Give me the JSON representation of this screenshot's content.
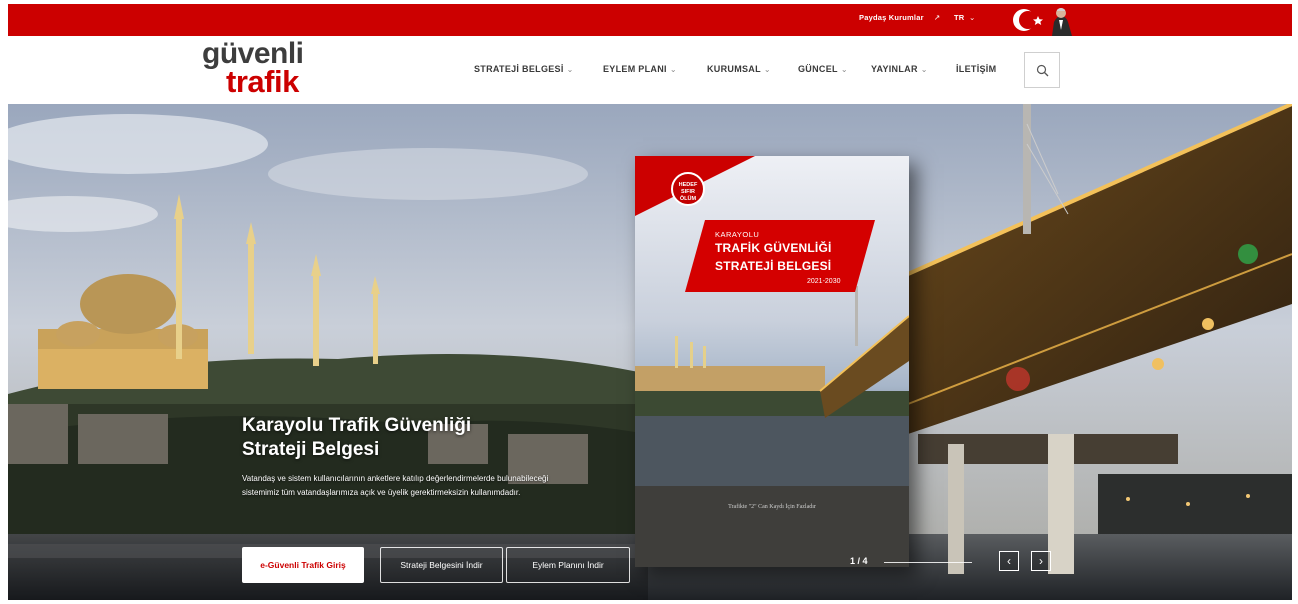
{
  "topbar": {
    "stakeholders_label": "Paydaş Kurumlar",
    "stakeholders_icon": "external-link-icon",
    "stakeholders_arrow": "↗",
    "language": "TR",
    "language_chevron": "⌄",
    "flag_icon": "turkish-flag-crescent-star-icon",
    "bg_color": "#cc0000"
  },
  "logo": {
    "line1": "güvenli",
    "line2": "trafik"
  },
  "nav": {
    "items": [
      {
        "label": "STRATEJİ BELGESİ",
        "chev": "⌄"
      },
      {
        "label": "EYLEM PLANI",
        "chev": "⌄"
      },
      {
        "label": "KURUMSAL",
        "chev": "⌄"
      },
      {
        "label": "GÜNCEL",
        "chev": "⌄"
      },
      {
        "label": "YAYINLAR",
        "chev": "⌄"
      },
      {
        "label": "İLETİŞİM",
        "chev": ""
      }
    ],
    "search_icon": "search-icon"
  },
  "hero": {
    "title_line1": "Karayolu Trafik Güvenliği",
    "title_line2": "Strateji Belgesi",
    "description": "Vatandaş ve sistem kullanıcılarının anketlere katılıp değerlendirmelerde bulunabileceği sistemimiz tüm vatandaşlarımıza açık ve üyelik gerektirmeksizin kullanımdadır.",
    "buttons": {
      "primary": "e-Güvenli Trafik Giriş",
      "strategy": "Strateji Belgesini İndir",
      "plan": "Eylem Planını İndir"
    },
    "pager": "1 / 4",
    "prev_arrow": "‹",
    "next_arrow": "›"
  },
  "book": {
    "badge": "HEDEF SIFIR ÖLÜM",
    "line1": "KARAYOLU",
    "line2": "TRAFİK GÜVENLİĞİ",
    "line3": "STRATEJİ BELGESİ",
    "years": "2021-2030",
    "footer": "Trafikte \"2\" Can Kaydı İçin Fazladır"
  },
  "colors": {
    "brand_red": "#cc0000",
    "logo_gray": "#3d3d3d"
  }
}
